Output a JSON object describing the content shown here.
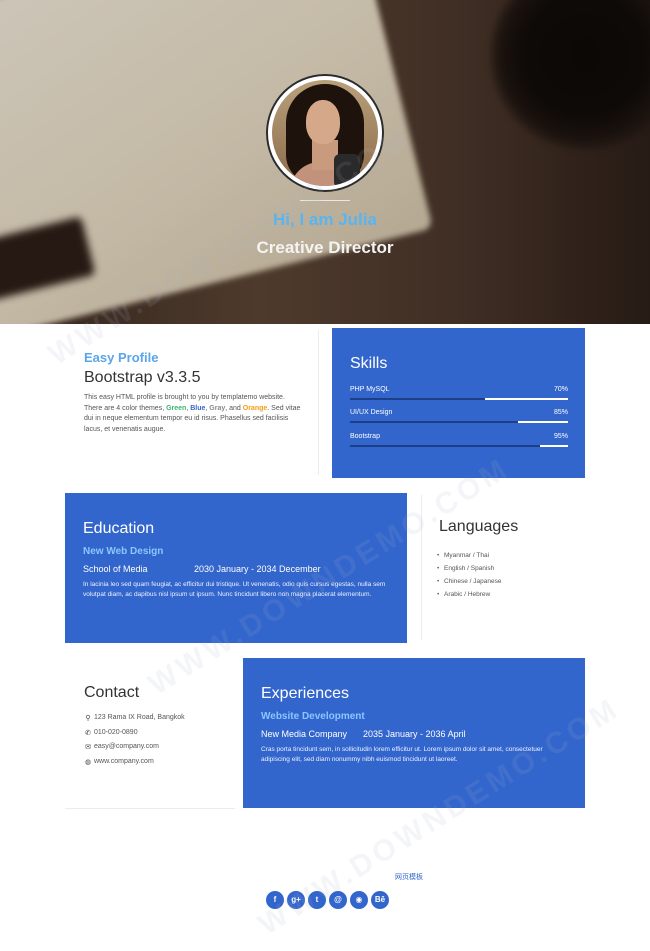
{
  "hero": {
    "greeting": "Hi, I am Julia",
    "title": "Creative Director"
  },
  "about": {
    "kicker": "Easy Profile",
    "heading": "Bootstrap v3.3.5",
    "text_before": "This easy HTML profile is brought to you by templatemo website. There are 4 color themes, ",
    "theme_green": "Green",
    "sep1": ", ",
    "theme_blue": "Blue",
    "sep2": ", ",
    "theme_gray": "Gray",
    "sep3": ", and ",
    "theme_orange": "Orange",
    "text_after": ". Sed vitae dui in neque elementum tempor eu id risus. Phasellus sed facilisis lacus, et venenatis augue."
  },
  "skills": {
    "title": "Skills",
    "items": [
      {
        "label": "PHP MySQL",
        "percent_text": "70%",
        "value": 0.7
      },
      {
        "label": "UI/UX Design",
        "percent_text": "85%",
        "value": 0.85
      },
      {
        "label": "Bootstrap",
        "percent_text": "95%",
        "value": 0.95
      }
    ]
  },
  "education": {
    "title": "Education",
    "subtitle": "New Web Design",
    "school": "School of Media",
    "period": "2030 January - 2034 December",
    "description": "In lacinia leo sed quam feugiat, ac efficitur dui tristique. Ut venenatis, odio quis cursus egestas, nulla sem volutpat diam, ac dapibus nisl ipsum ut ipsum. Nunc tincidunt libero non magna placerat elementum."
  },
  "languages": {
    "title": "Languages",
    "items": [
      "Myanmar / Thai",
      "English / Spanish",
      "Chinese / Japanese",
      "Arabic / Hebrew"
    ]
  },
  "contact": {
    "title": "Contact",
    "items": [
      {
        "icon": "map-marker-icon",
        "text": "123 Rama IX Road, Bangkok"
      },
      {
        "icon": "phone-icon",
        "text": "010-020-0890"
      },
      {
        "icon": "envelope-icon",
        "text": "easy@company.com"
      },
      {
        "icon": "globe-icon",
        "text": "www.company.com"
      }
    ]
  },
  "experiences": {
    "title": "Experiences",
    "subtitle": "Website Development",
    "company": "New Media Company",
    "period": "2035 January - 2036 April",
    "description": "Cras porta tincidunt sem, in sollicitudin lorem efficitur ut. Lorem ipsum dolor sit amet, consectetuer adipiscing elit, sed diam nonummy nibh euismod tincidunt ut laoreet."
  },
  "footer": {
    "link_text": "网页模板",
    "social": [
      {
        "icon": "facebook-icon",
        "glyph": "f"
      },
      {
        "icon": "google-plus-icon",
        "glyph": "g+"
      },
      {
        "icon": "twitter-icon",
        "glyph": "t"
      },
      {
        "icon": "email-icon",
        "glyph": "@"
      },
      {
        "icon": "github-icon",
        "glyph": "◉"
      },
      {
        "icon": "behance-icon",
        "glyph": "Bē"
      }
    ]
  },
  "watermark": "WWW.DOWNDEMO.COM",
  "colors": {
    "accent": "#3366cc",
    "highlight": "#5ab4f0"
  }
}
